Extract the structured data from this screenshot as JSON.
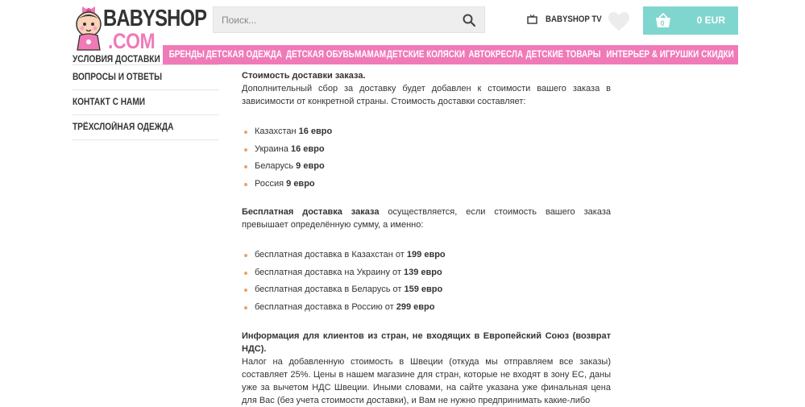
{
  "logo": {
    "line1": "BABYSHOP",
    "line2": ".COM"
  },
  "search": {
    "placeholder": "Поиск..."
  },
  "header": {
    "tv_label": "BABYSHOP TV"
  },
  "cart": {
    "count": "0",
    "total": "0 EUR"
  },
  "nav": {
    "items": [
      "БРЕНДЫ",
      "ДЕТСКАЯ ОДЕЖДА",
      "ДЕТСКАЯ ОБУВЬ",
      "МАМАМ",
      "ДЕТСКИЕ КОЛЯСКИ",
      "АВТОКРЕСЛА",
      "ДЕТСКИЕ ТОВАРЫ",
      "ИНТЕРЬЕР & ИГРУШКИ",
      "СКИДКИ"
    ]
  },
  "sidebar": {
    "items": [
      "УСЛОВИЯ ДОСТАВКИ",
      "ВОПРОСЫ И ОТВЕТЫ",
      "КОНТАКТ С НАМИ",
      "ТРЁХСЛОЙНАЯ ОДЕЖДА"
    ]
  },
  "content": {
    "cost_heading": "Стоимость доставки заказа.",
    "cost_text": "Дополнительный сбор за доставку будет добавлен к стоимости вашего заказа в зависимости от конкретной страны. Стоимость доставки составляет:",
    "cost_list": [
      {
        "country": "Казахстан",
        "price": "16 евро"
      },
      {
        "country": "Украина",
        "price": "16 евро"
      },
      {
        "country": "Беларусь",
        "price": "9 евро"
      },
      {
        "country": "Россия",
        "price": "9 евро"
      }
    ],
    "free_heading": "Бесплатная доставка заказа",
    "free_text": " осуществляется, если стоимость вашего заказа превышает определённую сумму, а именно:",
    "free_list": [
      {
        "text": "бесплатная доставка в Казахстан от",
        "price": "199 евро"
      },
      {
        "text": "бесплатная доставка на Украину от",
        "price": "139 евро"
      },
      {
        "text": "бесплатная доставка в Беларусь от",
        "price": "159 евро"
      },
      {
        "text": "бесплатная доставка в Россию от",
        "price": "299 евро"
      }
    ],
    "info_heading": "Информация для клиентов из стран, не входящих в Европейский Союз (возврат НДС).",
    "info_text": "Налог на добавленную стоимость в Швеции (откуда мы отправляем все заказы) составляет 25%. Цены в нашем магазине для стран, которые не входят в зону ЕС, даны уже за вычетом НДС Швеции. Иными словами, на сайте указана уже финальная цена для Вас (без учета стоимости доставки), и Вам не нужно предпринимать какие-либо"
  },
  "colors": {
    "pink": "#f07ab8",
    "teal": "#7fd6cf",
    "bullet": "#e8a46a"
  }
}
